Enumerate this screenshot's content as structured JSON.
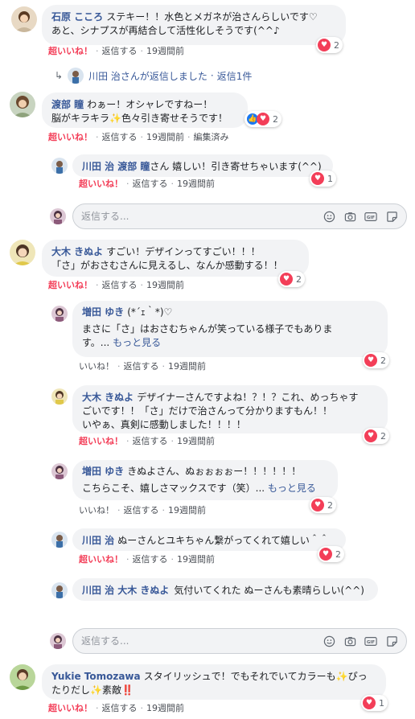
{
  "actions": {
    "super_like": "超いいね！",
    "like": "いいね！",
    "reply": "返信する",
    "sep": "·",
    "edited": "編集済み",
    "more": "もっと見る"
  },
  "reply_placeholder": "返信する...",
  "colors": {
    "name": "#385898",
    "super_like": "#f33e58",
    "bubble": "#f2f3f5"
  },
  "comments": [
    {
      "name": "石原 こころ",
      "line1": "ステキー！！水色とメガネが治さんらしいです♡",
      "line2": "あと、シナプスが再結合して活性化しそうです(^^♪",
      "time": "19週間前",
      "reactions": 2,
      "view_replies": {
        "name": "川田 治",
        "text": "さんが返信しました",
        "count": "返信1件"
      }
    },
    {
      "name": "渡部 瞳",
      "line1": "わぁー！オシャレですねー！",
      "line2": "脳がキラキラ✨色々引き寄せそうです！",
      "time": "19週間前",
      "reactions": 2,
      "reply": {
        "name": "川田 治",
        "mention": "渡部 瞳",
        "text": "さん 嬉しい！引き寄せちゃいます(^^)",
        "time": "19週間前",
        "reactions": 1
      }
    },
    {
      "name": "大木 きぬよ",
      "line1": "すごい！デザインってすごい！！！",
      "line2": "「さ」がおさむさんに見えるし、なんか感動する！！",
      "time": "19週間前",
      "reactions": 2,
      "replies": [
        {
          "name": "増田 ゆき",
          "line1": "(*´ｪ｀*)♡",
          "line2": "まさに「さ」はおさむちゃんが笑っている様子でもありま",
          "line3": "す。...",
          "time": "19週間前",
          "reactions": 2
        },
        {
          "name": "大木 きぬよ",
          "line1": "デザイナーさんですよね！？！？これ、めっちゃす",
          "line2": "ごいです！！「さ」だけで治さんって分かりますもん！！",
          "line3": "いやぁ、真剣に感動しました！！！！",
          "time": "19週間前",
          "reactions": 2
        },
        {
          "name": "増田 ゆき",
          "line1": "きぬよさん、ぬぉぉぉぉー！！！！！！",
          "line2": "こちらこそ、嬉しさマックスです（笑）...",
          "time": "19週間前",
          "reactions": 2
        },
        {
          "name": "川田 治",
          "line1": "ぬーさんとユキちゃん繋がってくれて嬉しい＾＾",
          "time": "19週間前",
          "reactions": 2
        },
        {
          "name": "川田 治",
          "mention": "大木 きぬよ",
          "line1": "気付いてくれた ぬーさんも素晴らしい(^^)"
        }
      ]
    },
    {
      "name": "Yukie Tomozawa",
      "line1": "スタイリッシュで！でもそれでいてカラーも✨ぴっ",
      "line2": "たりだし✨素敵‼️",
      "time": "19週間前",
      "reactions": 1
    }
  ]
}
